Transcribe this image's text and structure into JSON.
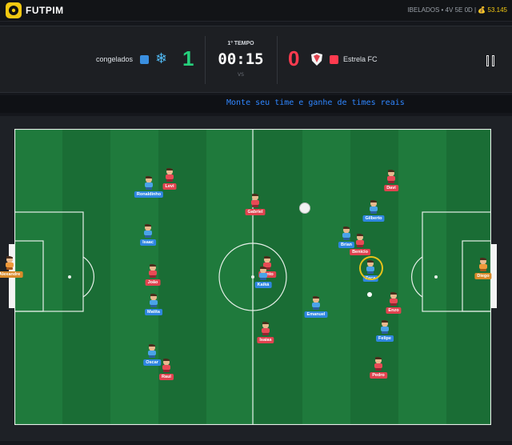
{
  "brand": {
    "name": "FUTPIM",
    "logo_color": "#f2c811"
  },
  "ticker": {
    "text": "IBELADOS • 4V 5E 0D  |",
    "coins": "💰 53.145"
  },
  "scoreboard": {
    "home": {
      "name": "congelados",
      "score": "1",
      "color": "#3a8fe0",
      "icon": "snowflake-icon",
      "icon_glyph": "❄"
    },
    "away": {
      "name": "Estrela FC",
      "score": "0",
      "color": "#ff3b4f",
      "icon": "shield-icon"
    },
    "period": "1º TEMPO",
    "clock": "00:15",
    "vs": "VS"
  },
  "marquee": {
    "text": "Monte seu time e ganhe de times reais"
  },
  "colors": {
    "pitch_light": "#1f7a3c",
    "pitch_dark": "#1a6d35",
    "home_label": "#2f86e0",
    "away_label": "#e0434f",
    "gk_label": "#d98a2a"
  },
  "players": [
    {
      "name": "Alexandre",
      "team": "gk",
      "kit": "orange"
    },
    {
      "name": "Ronaldinho",
      "team": "home",
      "kit": "blue"
    },
    {
      "name": "Levi",
      "team": "away",
      "kit": "red"
    },
    {
      "name": "Isaac",
      "team": "home",
      "kit": "blue"
    },
    {
      "name": "João",
      "team": "away",
      "kit": "red"
    },
    {
      "name": "Matita",
      "team": "home",
      "kit": "blue"
    },
    {
      "name": "Oscar",
      "team": "home",
      "kit": "blue"
    },
    {
      "name": "Raul",
      "team": "away",
      "kit": "red"
    },
    {
      "name": "Gabriel",
      "team": "away",
      "kit": "red"
    },
    {
      "name": "Bento",
      "team": "away",
      "kit": "red"
    },
    {
      "name": "Kaiká",
      "team": "home",
      "kit": "blue"
    },
    {
      "name": "Isaias",
      "team": "away",
      "kit": "red"
    },
    {
      "name": "Emanuel",
      "team": "home",
      "kit": "blue"
    },
    {
      "name": "Davi",
      "team": "away",
      "kit": "red"
    },
    {
      "name": "Gilberto",
      "team": "home",
      "kit": "blue"
    },
    {
      "name": "Brian",
      "team": "home",
      "kit": "blue"
    },
    {
      "name": "Benicio",
      "team": "away",
      "kit": "red"
    },
    {
      "name": "Zeca",
      "team": "home",
      "kit": "blue"
    },
    {
      "name": "Enzo",
      "team": "away",
      "kit": "red"
    },
    {
      "name": "Felipe",
      "team": "home",
      "kit": "blue"
    },
    {
      "name": "Pedro",
      "team": "away",
      "kit": "red"
    },
    {
      "name": "Diego",
      "team": "gk",
      "kit": "orange"
    }
  ]
}
